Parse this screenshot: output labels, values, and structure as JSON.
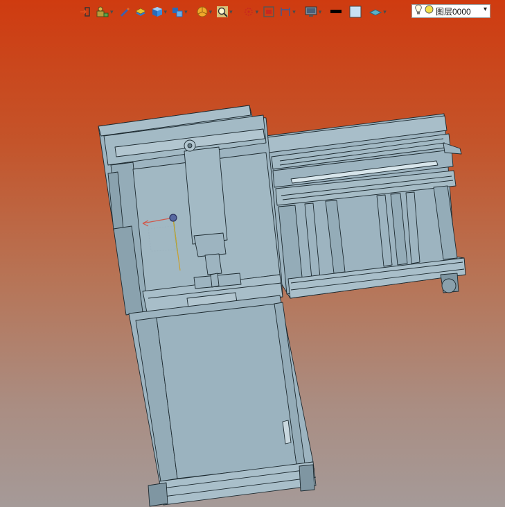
{
  "toolbar": {
    "tools": [
      {
        "icon": "import-icon",
        "has_menu": false
      },
      {
        "icon": "assembly-icon",
        "has_menu": true
      },
      {
        "icon": "pencil-icon",
        "has_menu": false
      },
      {
        "icon": "layer-stack-icon",
        "has_menu": false
      },
      {
        "icon": "cube-icon",
        "has_menu": true
      },
      {
        "icon": "multi-cube-icon",
        "has_menu": true
      },
      {
        "icon": "pie-section-icon",
        "has_menu": true
      },
      {
        "icon": "zoom-icon",
        "has_menu": true
      },
      {
        "icon": "snap-icon",
        "has_menu": true
      },
      {
        "icon": "frame-view-icon",
        "has_menu": false
      },
      {
        "icon": "dimension-icon",
        "has_menu": true
      },
      {
        "icon": "monitor-icon",
        "has_menu": true
      },
      {
        "icon": "line-color-icon",
        "has_menu": false
      },
      {
        "icon": "fill-color-icon",
        "has_menu": false
      },
      {
        "icon": "plane-icon",
        "has_menu": true
      }
    ],
    "line_color": "#000000",
    "fill_color": "#c8e0f4"
  },
  "layer_combo": {
    "label": "图层0000",
    "bulb_icon": "lightbulb-icon",
    "dot_color": "#f2e04a"
  },
  "viewport": {
    "background_top": "#cf3b10",
    "background_bottom": "#a59a98",
    "model_color": "#9db4c0",
    "edge_color": "#1d2a30"
  }
}
